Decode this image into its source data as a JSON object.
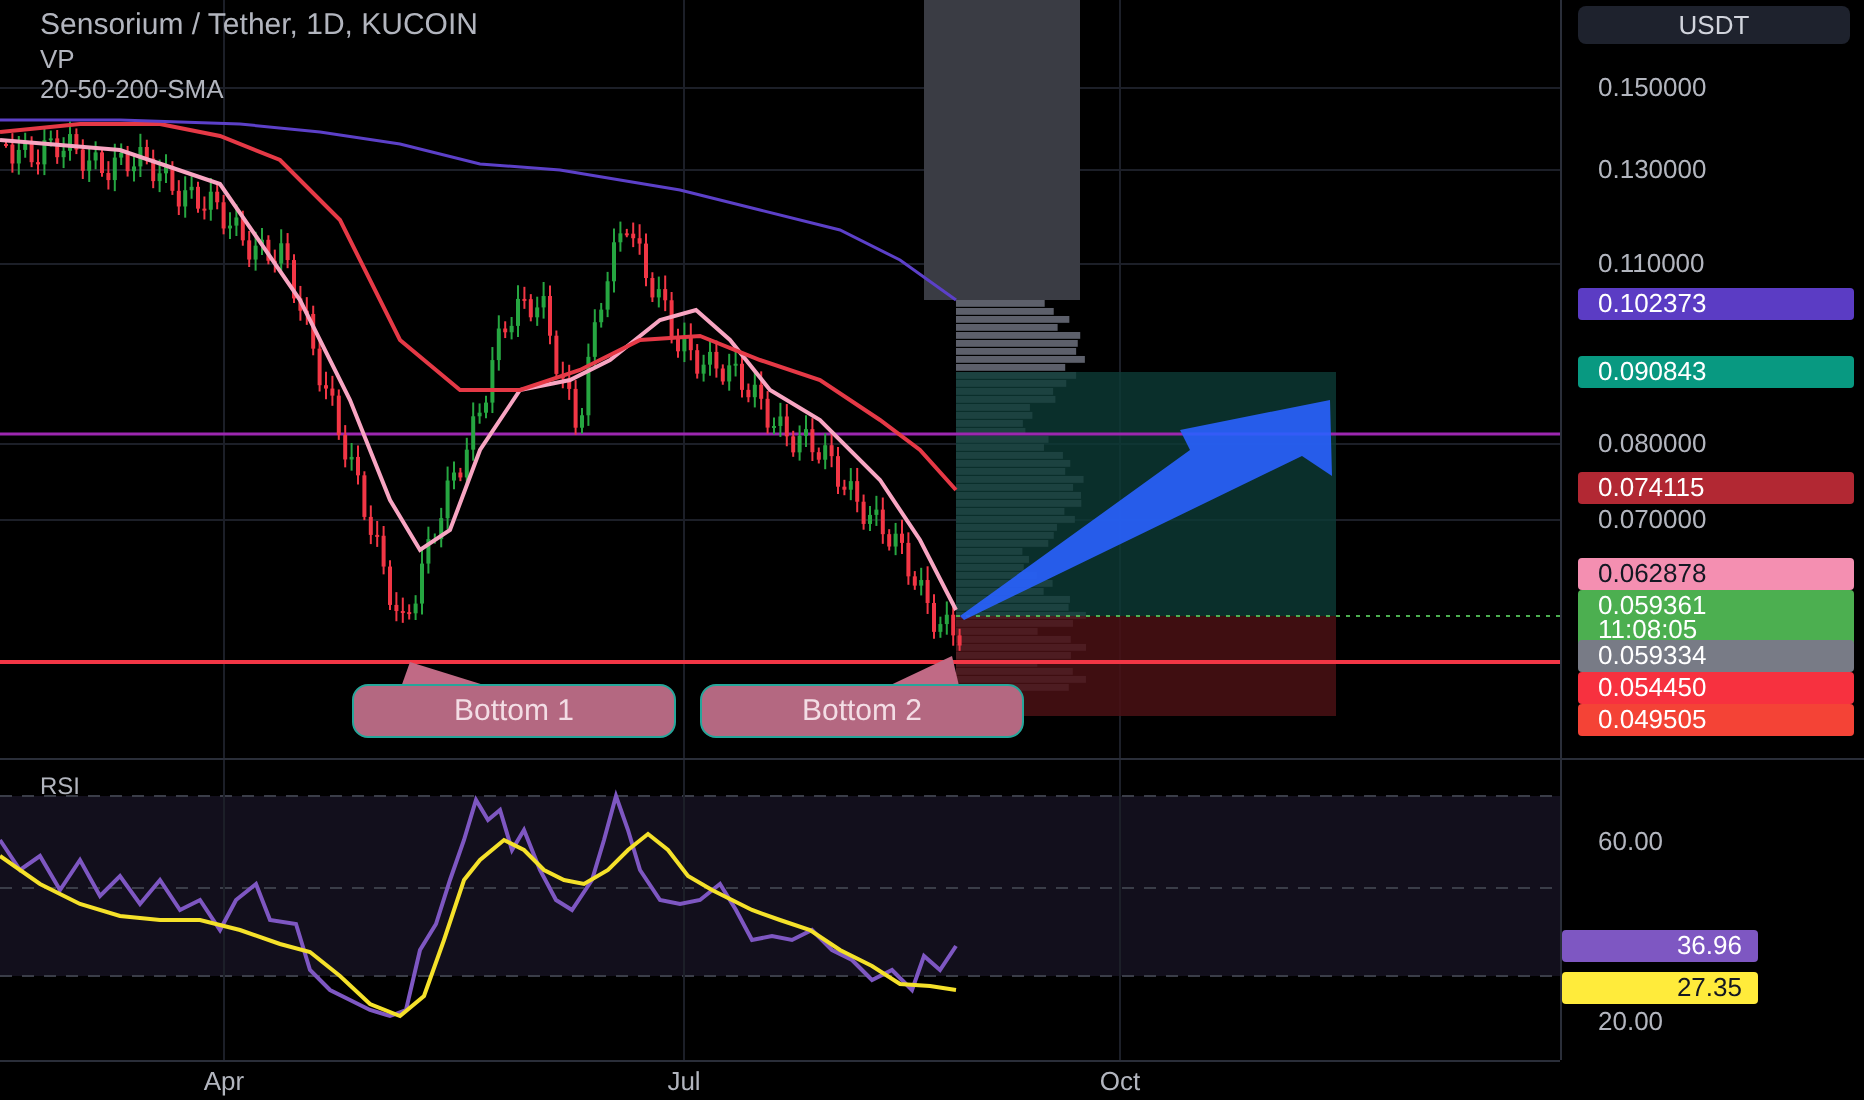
{
  "legend": {
    "title": "Sensorium / Tether, 1D, KUCOIN",
    "indicators": [
      "VP",
      "20-50-200-SMA"
    ]
  },
  "price_axis": {
    "currency": "USDT",
    "ticks": [
      "0.150000",
      "0.130000",
      "0.110000",
      "0.080000",
      "0.070000"
    ],
    "labels": [
      {
        "value": "0.102373",
        "color": "#5b3cc4"
      },
      {
        "value": "0.090843",
        "color": "#089981"
      },
      {
        "value": "0.074115",
        "color": "#b22833"
      },
      {
        "value": "0.062878",
        "color": "#f48fb1"
      },
      {
        "value": "0.059361",
        "countdown": "11:08:05",
        "color": "#4caf50"
      },
      {
        "value": "0.059334",
        "color": "#787b86"
      },
      {
        "value": "0.054450",
        "color": "#f7313f"
      },
      {
        "value": "0.049505",
        "color": "#f44336"
      }
    ]
  },
  "annotations": [
    {
      "text": "Bottom 1"
    },
    {
      "text": "Bottom 2"
    }
  ],
  "rsi": {
    "title": "RSI",
    "ticks": [
      "60.00",
      "20.00"
    ],
    "labels": [
      {
        "value": "36.96",
        "color": "#7e57c2"
      },
      {
        "value": "27.35",
        "color": "#ffeb3b"
      }
    ]
  },
  "time_axis": [
    "Apr",
    "Jul",
    "Oct"
  ]
}
